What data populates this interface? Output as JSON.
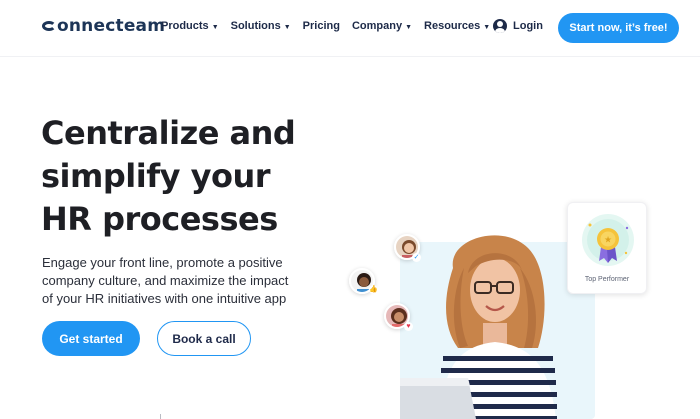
{
  "brand": {
    "name": "onnecteam"
  },
  "nav": {
    "items": [
      {
        "label": "Products",
        "has_dropdown": true
      },
      {
        "label": "Solutions",
        "has_dropdown": true
      },
      {
        "label": "Pricing",
        "has_dropdown": false
      },
      {
        "label": "Company",
        "has_dropdown": true
      },
      {
        "label": "Resources",
        "has_dropdown": true
      }
    ],
    "login_label": "Login",
    "cta_label": "Start now, it’s free!"
  },
  "hero": {
    "title_lines": [
      "Centralize and",
      "simplify your",
      "HR processes"
    ],
    "subtitle_lines": [
      "Engage your front line, promote a positive",
      "company culture, and maximize the impact",
      "of your HR initiatives with one intuitive app"
    ],
    "primary_button": "Get started",
    "secondary_button": "Book a call"
  },
  "illustration": {
    "card_label": "Top Performer",
    "icons": [
      "thumbs-up-icon",
      "heart-icon",
      "check-icon",
      "medal-icon"
    ]
  },
  "colors": {
    "accent": "#2196f3",
    "brand_text": "#1d3557",
    "heading": "#1e1f24"
  }
}
